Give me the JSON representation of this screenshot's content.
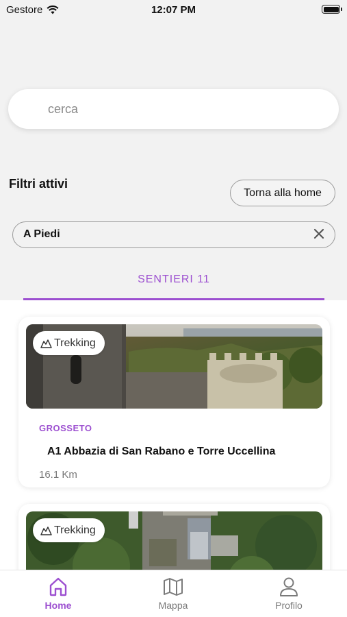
{
  "status_bar": {
    "carrier": "Gestore",
    "time": "12:07 PM"
  },
  "search": {
    "placeholder": "cerca",
    "value": ""
  },
  "filters": {
    "label": "Filtri attivi",
    "home_button": "Torna alla home",
    "active_chips": [
      {
        "label": "A Piedi"
      }
    ]
  },
  "tab": {
    "label": "SENTIERI 11"
  },
  "trails": [
    {
      "badge": "Trekking",
      "province": "GROSSETO",
      "title": "A1 Abbazia di San Rabano e Torre Uccellina",
      "distance": "16.1 Km"
    },
    {
      "badge": "Trekking"
    }
  ],
  "bottom_nav": {
    "items": [
      {
        "label": "Home",
        "icon": "home-icon",
        "active": true
      },
      {
        "label": "Mappa",
        "icon": "map-icon",
        "active": false
      },
      {
        "label": "Profilo",
        "icon": "profile-icon",
        "active": false
      }
    ]
  },
  "colors": {
    "accent": "#9c4fd0",
    "background": "#f2f2f2"
  }
}
